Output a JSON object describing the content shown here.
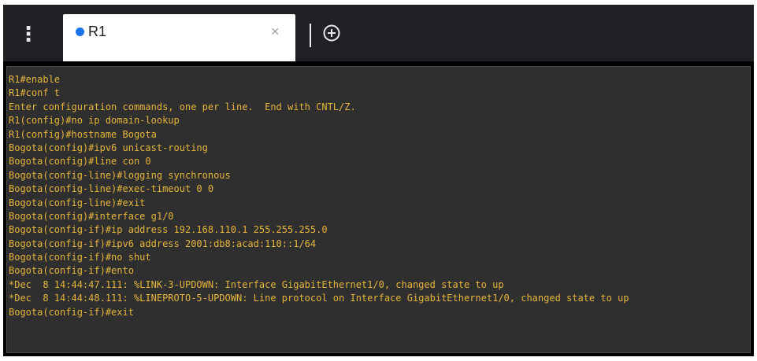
{
  "colors": {
    "tab_bar_bg": "#202124",
    "tab_bg": "#ffffff",
    "tab_status_dot": "#1a73e8",
    "terminal_bg": "#2f2f2f",
    "terminal_text": "#e5b53b",
    "frame": "#000000"
  },
  "tab_bar": {
    "menu_icon": "vertical-ellipsis-icon",
    "new_tab_icon": "plus-circle-icon"
  },
  "tab": {
    "title": "R1",
    "close_symbol": "×",
    "status": "connected"
  },
  "terminal": {
    "lines": [
      "R1#enable",
      "R1#conf t",
      "Enter configuration commands, one per line.  End with CNTL/Z.",
      "R1(config)#no ip domain-lookup",
      "R1(config)#hostname Bogota",
      "Bogota(config)#ipv6 unicast-routing",
      "Bogota(config)#line con 0",
      "Bogota(config-line)#logging synchronous",
      "Bogota(config-line)#exec-timeout 0 0",
      "Bogota(config-line)#exit",
      "Bogota(config)#interface g1/0",
      "Bogota(config-if)#ip address 192.168.110.1 255.255.255.0",
      "Bogota(config-if)#ipv6 address 2001:db8:acad:110::1/64",
      "Bogota(config-if)#no shut",
      "Bogota(config-if)#ento",
      "*Dec  8 14:44:47.111: %LINK-3-UPDOWN: Interface GigabitEthernet1/0, changed state to up",
      "*Dec  8 14:44:48.111: %LINEPROTO-5-UPDOWN: Line protocol on Interface GigabitEthernet1/0, changed state to up",
      "Bogota(config-if)#exit"
    ]
  }
}
